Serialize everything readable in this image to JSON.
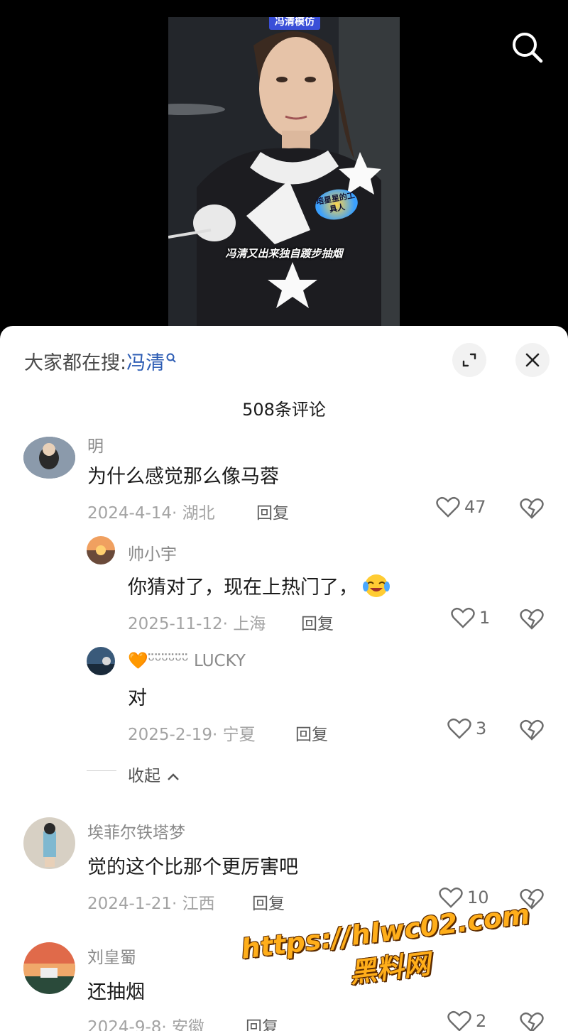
{
  "video": {
    "tag": "冯清模仿",
    "caption": "冯清又出来独自踱步抽烟",
    "logo_text": "培星星的工具人"
  },
  "sheet": {
    "hot_search_label": "大家都在搜:",
    "hot_search_term": "冯清",
    "comment_count": "508条评论",
    "collapse_label": "收起"
  },
  "comments": [
    {
      "username": "明",
      "text": "为什么感觉那么像马蓉",
      "meta": "2024-4-14· 湖北",
      "reply": "回复",
      "likes": "47"
    },
    {
      "username": "帅小宇",
      "text": "你猜对了，现在上热门了，",
      "emoji": "crying-laughing-emoji",
      "meta": "2025-11-12· 上海",
      "reply": "回复",
      "likes": "1"
    },
    {
      "username": "🧡ᵕ̈ᵕ̈ᵕ̈ᵕ̈ᵕ̈ᵕ̈ LUCKY",
      "text": "对",
      "meta": "2025-2-19· 宁夏",
      "reply": "回复",
      "likes": "3"
    },
    {
      "username": "埃菲尔铁塔梦",
      "text": "觉的这个比那个更厉害吧",
      "meta": "2024-1-21· 江西",
      "reply": "回复",
      "likes": "10"
    },
    {
      "username": "刘皇蜀",
      "text": "还抽烟",
      "meta": "2024-9-8· 安徽",
      "reply": "回复",
      "likes": "2"
    }
  ],
  "watermark": {
    "line1": "https://hlwc02.com",
    "line2": "黑料网"
  },
  "colors": {
    "search_term": "#2d5db4",
    "watermark": "#ffae1a",
    "sheet_bg": "#ffffff"
  }
}
